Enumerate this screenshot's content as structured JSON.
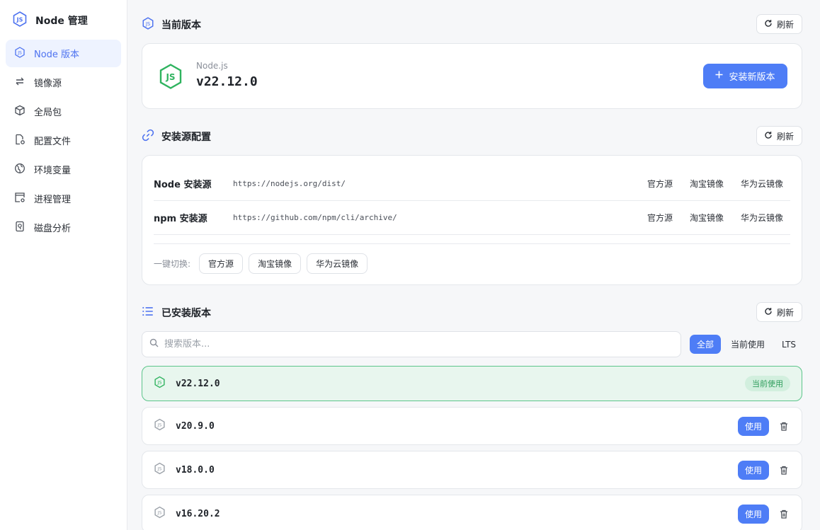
{
  "app": {
    "title": "Node 管理"
  },
  "sidebar": {
    "items": [
      {
        "label": "Node 版本",
        "icon": "node-js-icon",
        "active": true
      },
      {
        "label": "镜像源",
        "icon": "swap-arrows-icon"
      },
      {
        "label": "全局包",
        "icon": "package-cube-icon"
      },
      {
        "label": "配置文件",
        "icon": "file-settings-icon"
      },
      {
        "label": "环境变量",
        "icon": "globe-icon"
      },
      {
        "label": "进程管理",
        "icon": "window-settings-icon"
      },
      {
        "label": "磁盘分析",
        "icon": "disk-icon"
      }
    ]
  },
  "current": {
    "section_title": "当前版本",
    "refresh_label": "刷新",
    "runtime_label": "Node.js",
    "version": "v22.12.0",
    "install_label": "安装新版本"
  },
  "sources": {
    "section_title": "安装源配置",
    "refresh_label": "刷新",
    "rows": [
      {
        "name": "Node 安装源",
        "url": "https://nodejs.org/dist/",
        "options": [
          "官方源",
          "淘宝镜像",
          "华为云镜像"
        ]
      },
      {
        "name": "npm 安装源",
        "url": "https://github.com/npm/cli/archive/",
        "options": [
          "官方源",
          "淘宝镜像",
          "华为云镜像"
        ]
      }
    ],
    "quick_label": "一键切换:",
    "quick_options": [
      "官方源",
      "淘宝镜像",
      "华为云镜像"
    ]
  },
  "installed": {
    "section_title": "已安装版本",
    "refresh_label": "刷新",
    "search_placeholder": "搜索版本...",
    "filters": [
      "全部",
      "当前使用",
      "LTS"
    ],
    "active_filter": "全部",
    "current_badge": "当前使用",
    "use_label": "使用",
    "versions": [
      "v22.12.0",
      "v20.9.0",
      "v18.0.0",
      "v16.20.2"
    ],
    "current_version": "v22.12.0"
  },
  "colors": {
    "accent": "#4e7df6",
    "node_green": "#2fb35f",
    "current_bg": "#e8f6ee"
  }
}
